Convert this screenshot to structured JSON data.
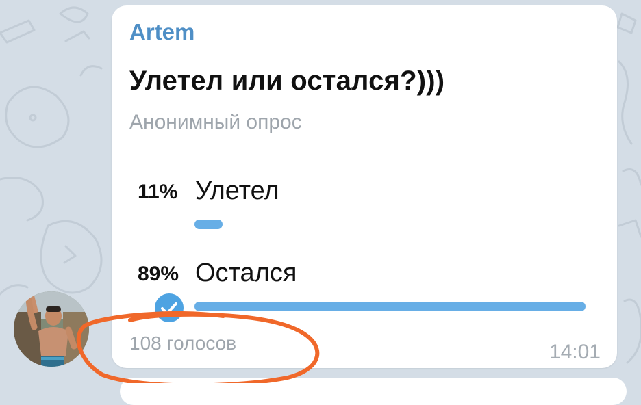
{
  "message": {
    "sender": "Artem",
    "poll": {
      "question": "Улетел или остался?)))",
      "type_label": "Анонимный опрос",
      "options": [
        {
          "percent_label": "11%",
          "label": "Улетел",
          "fraction": 0.11,
          "chosen": false
        },
        {
          "percent_label": "89%",
          "label": "Остался",
          "fraction": 0.89,
          "chosen": true
        }
      ],
      "votes_label": "108 голосов"
    },
    "time": "14:01"
  },
  "colors": {
    "accent": "#4f8fc6",
    "bar": "#67aee6",
    "check": "#4ea3e2",
    "annotation": "#f0682a",
    "wallpaper": "#d4dde6"
  },
  "icons": {
    "check": "check-icon",
    "avatar": "avatar-photo"
  }
}
